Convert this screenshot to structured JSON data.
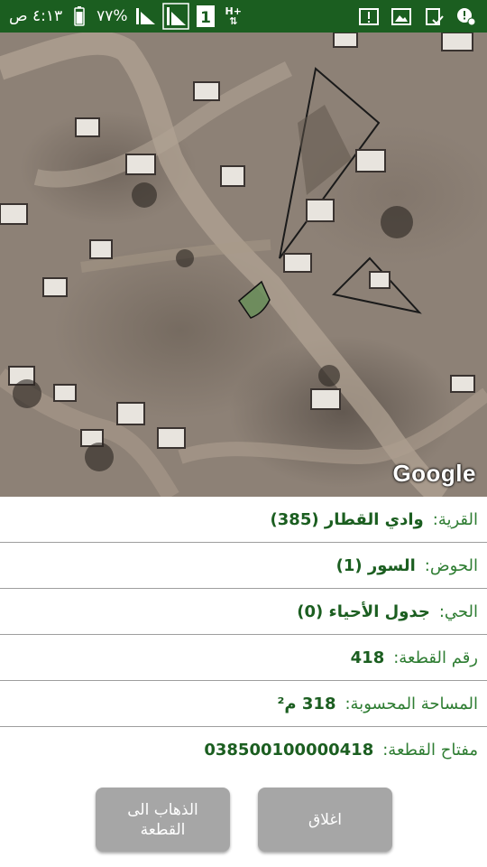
{
  "status_bar": {
    "time": "٤:١٣ ص",
    "battery": "٧٧%",
    "sim_slot": "1",
    "network_type": "H+"
  },
  "map": {
    "attribution": "Google"
  },
  "parcel_info": [
    {
      "label": "القرية:",
      "value": "وادي القطار (385)"
    },
    {
      "label": "الحوض:",
      "value": "السور (1)"
    },
    {
      "label": "الحي:",
      "value": "جدول الأحياء (0)"
    },
    {
      "label": "رقم القطعة:",
      "value": "418"
    },
    {
      "label": "المساحة المحسوبة:",
      "value": "318 م²"
    },
    {
      "label": "مفتاح القطعة:",
      "value": "038500100000418"
    }
  ],
  "buttons": {
    "goto_label": "الذهاب الى القطعة",
    "close_label": "اغلاق"
  },
  "colors": {
    "status_bar": "#1b5e20",
    "label_green": "#2e7d32",
    "value_green": "#1b5e20",
    "button_gray": "#a6a6a6",
    "parcel_fill": "#6a8f5a"
  }
}
